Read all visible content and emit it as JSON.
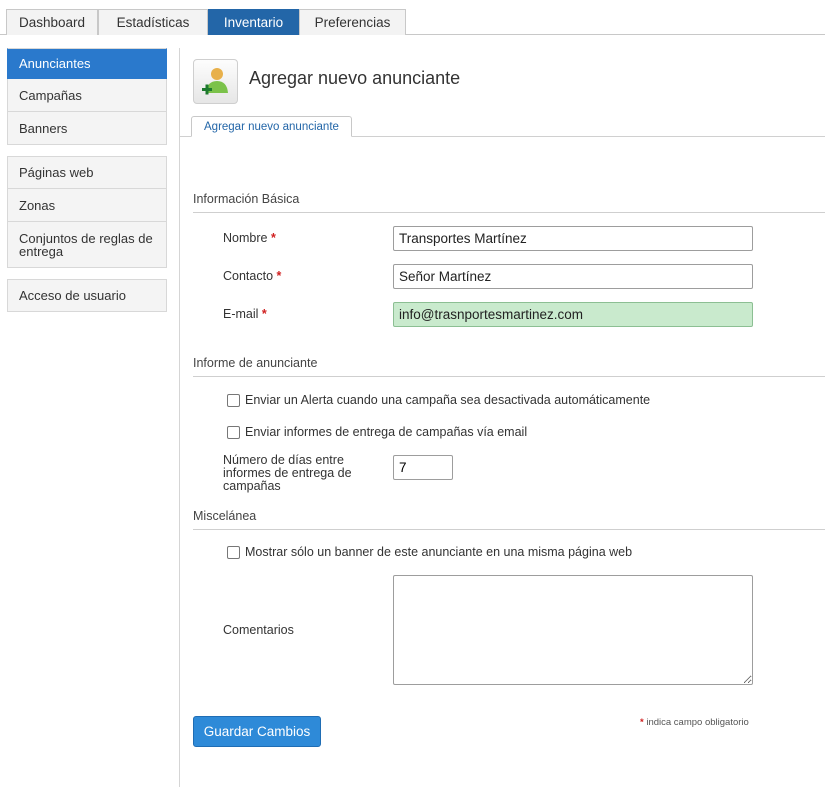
{
  "top_tabs": [
    "Dashboard",
    "Estadísticas",
    "Inventario",
    "Preferencias"
  ],
  "sidebar": {
    "group1": [
      "Anunciantes",
      "Campañas",
      "Banners"
    ],
    "group2": [
      "Páginas web",
      "Zonas",
      "Conjuntos de reglas de entrega"
    ],
    "group3": [
      "Acceso de usuario"
    ]
  },
  "header": {
    "title": "Agregar nuevo anunciante",
    "icon": "add-user-icon",
    "subtab": "Agregar nuevo anunciante"
  },
  "sections": {
    "basic": "Información Básica",
    "report": "Informe de anunciante",
    "misc": "Miscelánea"
  },
  "form": {
    "name_label": "Nombre",
    "name_value": "Transportes Martínez",
    "contact_label": "Contacto",
    "contact_value": "Señor Martínez",
    "email_label": "E-mail",
    "email_value": "info@trasnportesmartinez.com",
    "required_mark": "*",
    "alert_label": "Enviar un Alerta cuando una campaña sea desactivada automáticamente",
    "reports_label": "Enviar informes de entrega de campañas vía email",
    "days_label": "Número de días entre informes de entrega de campañas",
    "days_value": "7",
    "one_banner_label": "Mostrar sólo un banner de este anunciante en una misma página web",
    "comments_label": "Comentarios",
    "save_label": "Guardar Cambios",
    "required_note": "indica campo obligatorio"
  },
  "colors": {
    "accent": "#2366a8",
    "sidebar_active": "#2a79cc",
    "focused_input": "#c9eacd",
    "button": "#2e8ad8",
    "required": "#d02020"
  }
}
